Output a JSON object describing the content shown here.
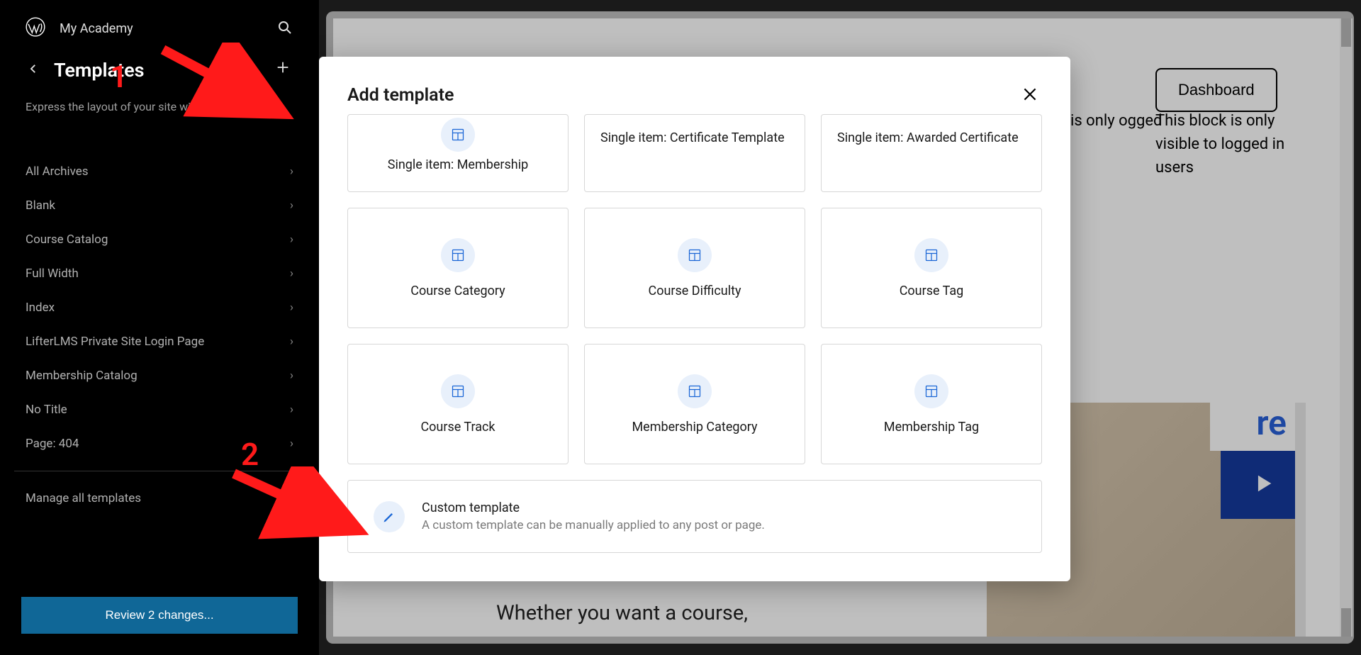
{
  "site_title": "My Academy",
  "sidebar": {
    "title": "Templates",
    "description": "Express the layout of your site with templates",
    "items": [
      {
        "label": "All Archives"
      },
      {
        "label": "Blank"
      },
      {
        "label": "Course Catalog"
      },
      {
        "label": "Full Width"
      },
      {
        "label": "Index"
      },
      {
        "label": "LifterLMS Private Site Login Page"
      },
      {
        "label": "Membership Catalog"
      },
      {
        "label": "No Title"
      },
      {
        "label": "Page: 404"
      }
    ],
    "manage_label": "Manage all templates",
    "review_label": "Review 2 changes..."
  },
  "canvas": {
    "dashboard_btn": "Dashboard",
    "block_msg": "This block is only visible to logged in users",
    "block_msg_short": "is only ogged",
    "caption": "Whether you want a course,",
    "video_text": "re"
  },
  "modal": {
    "title": "Add template",
    "row1": [
      {
        "label": "Single item: Membership",
        "icon": true
      },
      {
        "label": "Single item: Certificate Template",
        "icon": false
      },
      {
        "label": "Single item: Awarded Certificate",
        "icon": false
      }
    ],
    "row2": [
      {
        "label": "Course Category"
      },
      {
        "label": "Course Difficulty"
      },
      {
        "label": "Course Tag"
      }
    ],
    "row3": [
      {
        "label": "Course Track"
      },
      {
        "label": "Membership Category"
      },
      {
        "label": "Membership Tag"
      }
    ],
    "custom": {
      "title": "Custom template",
      "description": "A custom template can be manually applied to any post or page."
    }
  },
  "annotations": {
    "num1": "1",
    "num2": "2"
  }
}
